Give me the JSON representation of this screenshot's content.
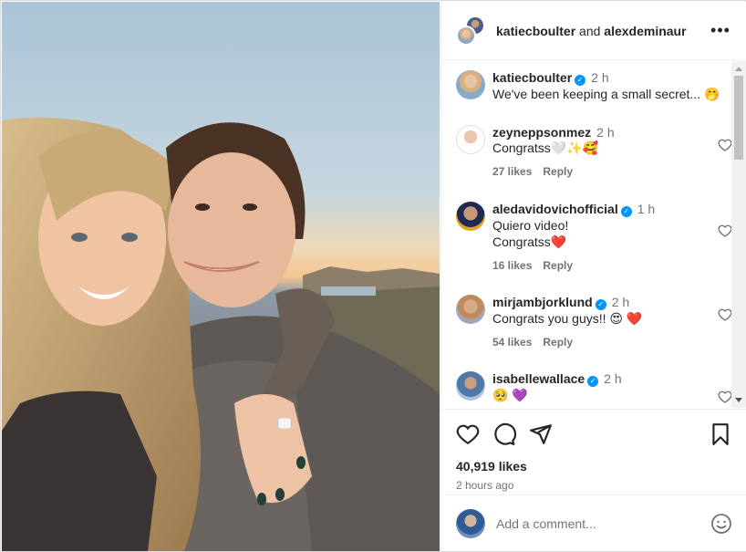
{
  "header": {
    "user1": "katiecboulter",
    "and": "and",
    "user2": "alexdeminaur",
    "more_icon": "ellipsis-icon"
  },
  "comments": [
    {
      "username": "katiecboulter",
      "verified": true,
      "time": "2 h",
      "text": "We've been keeping a small secret... 🤭",
      "likes": "",
      "reply": ""
    },
    {
      "username": "zeyneppsonmez",
      "verified": false,
      "time": "2 h",
      "text": "Congratss🤍✨🥰",
      "likes": "27 likes",
      "reply": "Reply"
    },
    {
      "username": "aledavidovichofficial",
      "verified": true,
      "time": "1 h",
      "text": "Quiero video!\nCongratss❤️",
      "likes": "16 likes",
      "reply": "Reply"
    },
    {
      "username": "mirjambjorklund",
      "verified": true,
      "time": "2 h",
      "text": "Congrats you guys!! 😍 ❤️",
      "likes": "54 likes",
      "reply": "Reply"
    },
    {
      "username": "isabellewallace",
      "verified": true,
      "time": "2 h",
      "text": "🥺 💜",
      "likes": "",
      "reply": ""
    }
  ],
  "post": {
    "likes": "40,919 likes",
    "time_ago": "2 hours ago"
  },
  "add_comment": {
    "placeholder": "Add a comment..."
  },
  "colors": {
    "verified": "#0095f6",
    "muted": "#737373",
    "text": "#262626"
  }
}
